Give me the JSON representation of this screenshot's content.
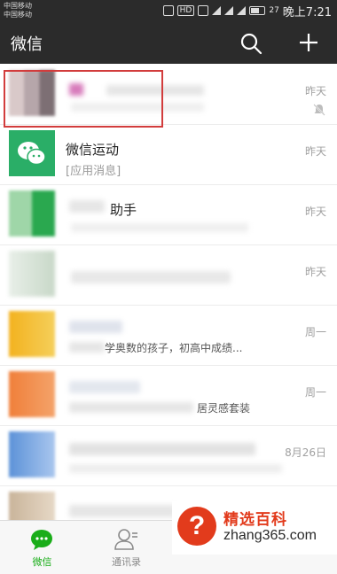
{
  "status_bar": {
    "carrier_1": "中国移动",
    "carrier_2": "中国移动",
    "network_label": "HD",
    "battery_level": "27",
    "clock": "晚上7:21"
  },
  "header": {
    "title": "微信",
    "search_icon": "search-icon",
    "add_icon": "plus-icon"
  },
  "chats": [
    {
      "time": "昨天",
      "muted": true
    },
    {
      "name": "微信运动",
      "subtitle": "[应用消息]",
      "time": "昨天",
      "avatar_color": "#2aae67",
      "highlighted": true
    },
    {
      "name": "助手",
      "time": "昨天"
    },
    {
      "time": "昨天"
    },
    {
      "snippet": "学奥数的孩子，初高中成绩...",
      "time": "周一"
    },
    {
      "snippet": "居灵感套装",
      "time": "周一"
    },
    {
      "time": "8月26日"
    }
  ],
  "tabs": [
    {
      "label": "微信",
      "icon": "chat-bubble-icon",
      "active": true
    },
    {
      "label": "通讯录",
      "icon": "contacts-icon",
      "active": false
    }
  ],
  "watermark": {
    "symbol": "?",
    "title": "精选百科",
    "url": "zhang365.com"
  },
  "colors": {
    "header_bg": "#2b2b2b",
    "accent_green": "#1aad19",
    "highlight_red": "#d23c3c",
    "watermark_red": "#e23b1c"
  }
}
